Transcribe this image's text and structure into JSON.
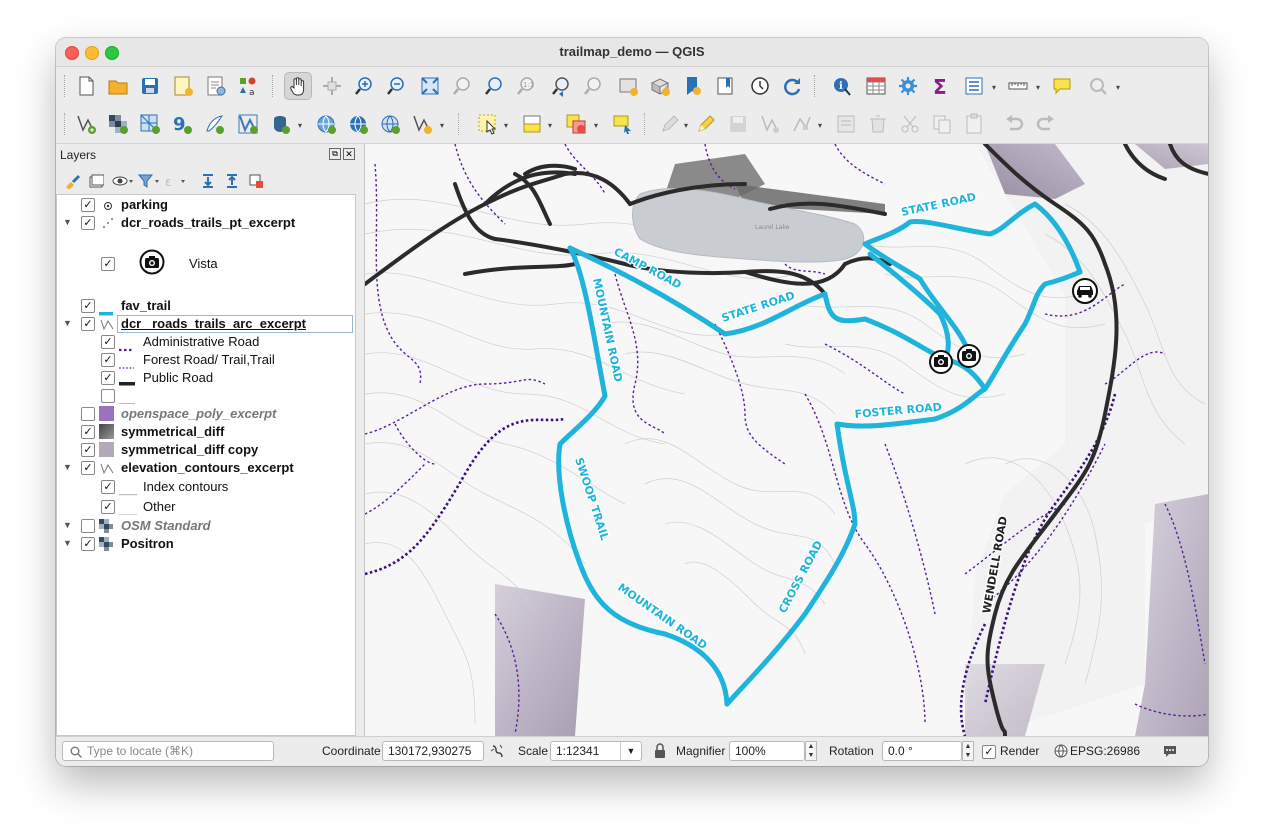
{
  "window": {
    "title": "trailmap_demo — QGIS"
  },
  "layers_panel": {
    "title": "Layers",
    "items": [
      {
        "label": "parking"
      },
      {
        "label": "dcr_roads_trails_pt_excerpt"
      },
      {
        "label": "Vista"
      },
      {
        "label": "fav_trail"
      },
      {
        "label": "dcr _roads_trails_arc_excerpt"
      },
      {
        "label": "Administrative Road"
      },
      {
        "label": "Forest Road/ Trail,Trail"
      },
      {
        "label": "Public Road"
      },
      {
        "label": ""
      },
      {
        "label": "openspace_poly_excerpt"
      },
      {
        "label": "symmetrical_diff"
      },
      {
        "label": "symmetrical_diff copy"
      },
      {
        "label": "elevation_contours_excerpt"
      },
      {
        "label": "Index contours"
      },
      {
        "label": "Other"
      },
      {
        "label": "OSM Standard"
      },
      {
        "label": "Positron"
      }
    ]
  },
  "map": {
    "labels": {
      "state_road_1": "STATE ROAD",
      "camp_road": "CAMP ROAD",
      "state_road_2": "STATE ROAD",
      "mountain_road_1": "MOUNTAIN ROAD",
      "foster_road": "FOSTER ROAD",
      "swoop_trail": "SWOOP TRAIL",
      "cross_road": "CROSS ROAD",
      "mountain_road_2": "MOUNTAIN ROAD",
      "wendell_road": "WENDELL ROAD",
      "lake": "Laurel Lake"
    },
    "colors": {
      "trail": "#1fb4dc",
      "public_road": "#2b2b2b",
      "forest_trail": "#5a1e96"
    }
  },
  "statusbar": {
    "locate_placeholder": "Type to locate (⌘K)",
    "coordinate_label": "Coordinate",
    "coordinate_value": "130172,930275",
    "scale_label": "Scale",
    "scale_value": "1:12341",
    "magnifier_label": "Magnifier",
    "magnifier_value": "100%",
    "rotation_label": "Rotation",
    "rotation_value": "0.0 °",
    "render_label": "Render",
    "crs": "EPSG:26986"
  }
}
